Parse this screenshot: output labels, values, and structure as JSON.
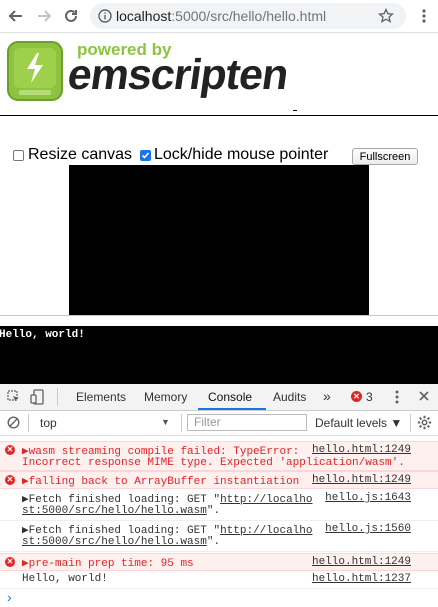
{
  "browser": {
    "url_host": "localhost",
    "url_path": ":5000/src/hello/hello.html"
  },
  "logo": {
    "tagline": "powered by",
    "wordmark": "emscripten"
  },
  "controls": {
    "resize_label": "Resize canvas",
    "resize_checked": false,
    "lock_label": "Lock/hide mouse pointer",
    "lock_checked": true,
    "fullscreen_label": "Fullscreen"
  },
  "output": {
    "text": "Hello, world!"
  },
  "devtools": {
    "tabs": [
      "Elements",
      "Memory",
      "Console",
      "Audits"
    ],
    "active_tab": "Console",
    "more_tabs": "»",
    "error_count": "3",
    "context": "top",
    "filter_placeholder": "Filter",
    "levels": "Default levels ▼",
    "messages": [
      {
        "type": "error",
        "line1": "▶wasm streaming compile failed: TypeError:",
        "line2": "Incorrect response MIME type. Expected 'application/wasm'.",
        "source": "hello.html:1249"
      },
      {
        "type": "error",
        "line1": "▶falling back to ArrayBuffer instantiation",
        "line2": "",
        "source": "hello.html:1249"
      },
      {
        "type": "info",
        "line1_prefix": "▶Fetch finished loading: GET \"",
        "line1_link": "http://localho",
        "line2_link": "st:5000/src/hello/hello.wasm",
        "line2_suffix": "\".",
        "source": "hello.js:1643"
      },
      {
        "type": "info",
        "line1_prefix": "▶Fetch finished loading: GET \"",
        "line1_link": "http://localho",
        "line2_link": "st:5000/src/hello/hello.wasm",
        "line2_suffix": "\".",
        "source": "hello.js:1560"
      },
      {
        "type": "error",
        "line1": "▶pre-main prep time: 95 ms",
        "line2": "",
        "source": "hello.html:1249"
      },
      {
        "type": "log",
        "line1": "Hello, world!",
        "line2": "",
        "source": "hello.html:1237"
      }
    ],
    "prompt": "›"
  },
  "colors": {
    "accent": "#1a73e8",
    "error": "#e32424",
    "error_bg": "#fff0f0",
    "emscripten_green": "#8cc43f"
  }
}
